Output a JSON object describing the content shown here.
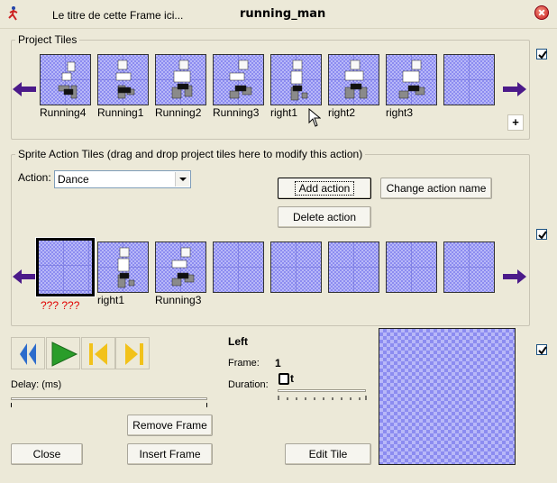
{
  "window": {
    "subtitle": "Le titre de cette Frame ici...",
    "title": "running_man"
  },
  "project_tiles": {
    "legend": "Project Tiles",
    "tiles": [
      {
        "label": "Running4",
        "pose": "run4"
      },
      {
        "label": "Running1",
        "pose": "run1"
      },
      {
        "label": "Running2",
        "pose": "run2"
      },
      {
        "label": "Running3",
        "pose": "run3"
      },
      {
        "label": "right1",
        "pose": "right1"
      },
      {
        "label": "right2",
        "pose": "right2"
      },
      {
        "label": "right3",
        "pose": "right3"
      },
      {
        "label": "",
        "pose": "empty"
      }
    ],
    "add_label": "+"
  },
  "sprite_action": {
    "legend": "Sprite Action Tiles (drag and drop project tiles here to modify this action)",
    "action_label": "Action:",
    "action_value": "Dance",
    "add_action": "Add action",
    "change_action_name": "Change action name",
    "delete_action": "Delete action",
    "tiles": [
      {
        "label": "??? ???",
        "pose": "empty",
        "selected": true
      },
      {
        "label": "right1",
        "pose": "right1"
      },
      {
        "label": "Running3",
        "pose": "run3"
      },
      {
        "label": "",
        "pose": "empty"
      },
      {
        "label": "",
        "pose": "empty"
      },
      {
        "label": "",
        "pose": "empty"
      },
      {
        "label": "",
        "pose": "empty"
      },
      {
        "label": "",
        "pose": "empty"
      }
    ]
  },
  "playback": {
    "delay_label": "Delay: (ms)",
    "direction": "Left",
    "frame_label": "Frame:",
    "frame_value": "1",
    "duration_label": "Duration:",
    "duration_unit": "t",
    "remove_frame": "Remove Frame",
    "close": "Close",
    "insert_frame": "Insert Frame",
    "edit_tile": "Edit Tile"
  },
  "colors": {
    "arrow": "#4b1a8a",
    "tile_bg": "#b8b8f8",
    "media_blue": "#2d6ccc",
    "media_green": "#2a9d2a",
    "media_yellow": "#f2c21a",
    "error_label": "#e00000"
  }
}
